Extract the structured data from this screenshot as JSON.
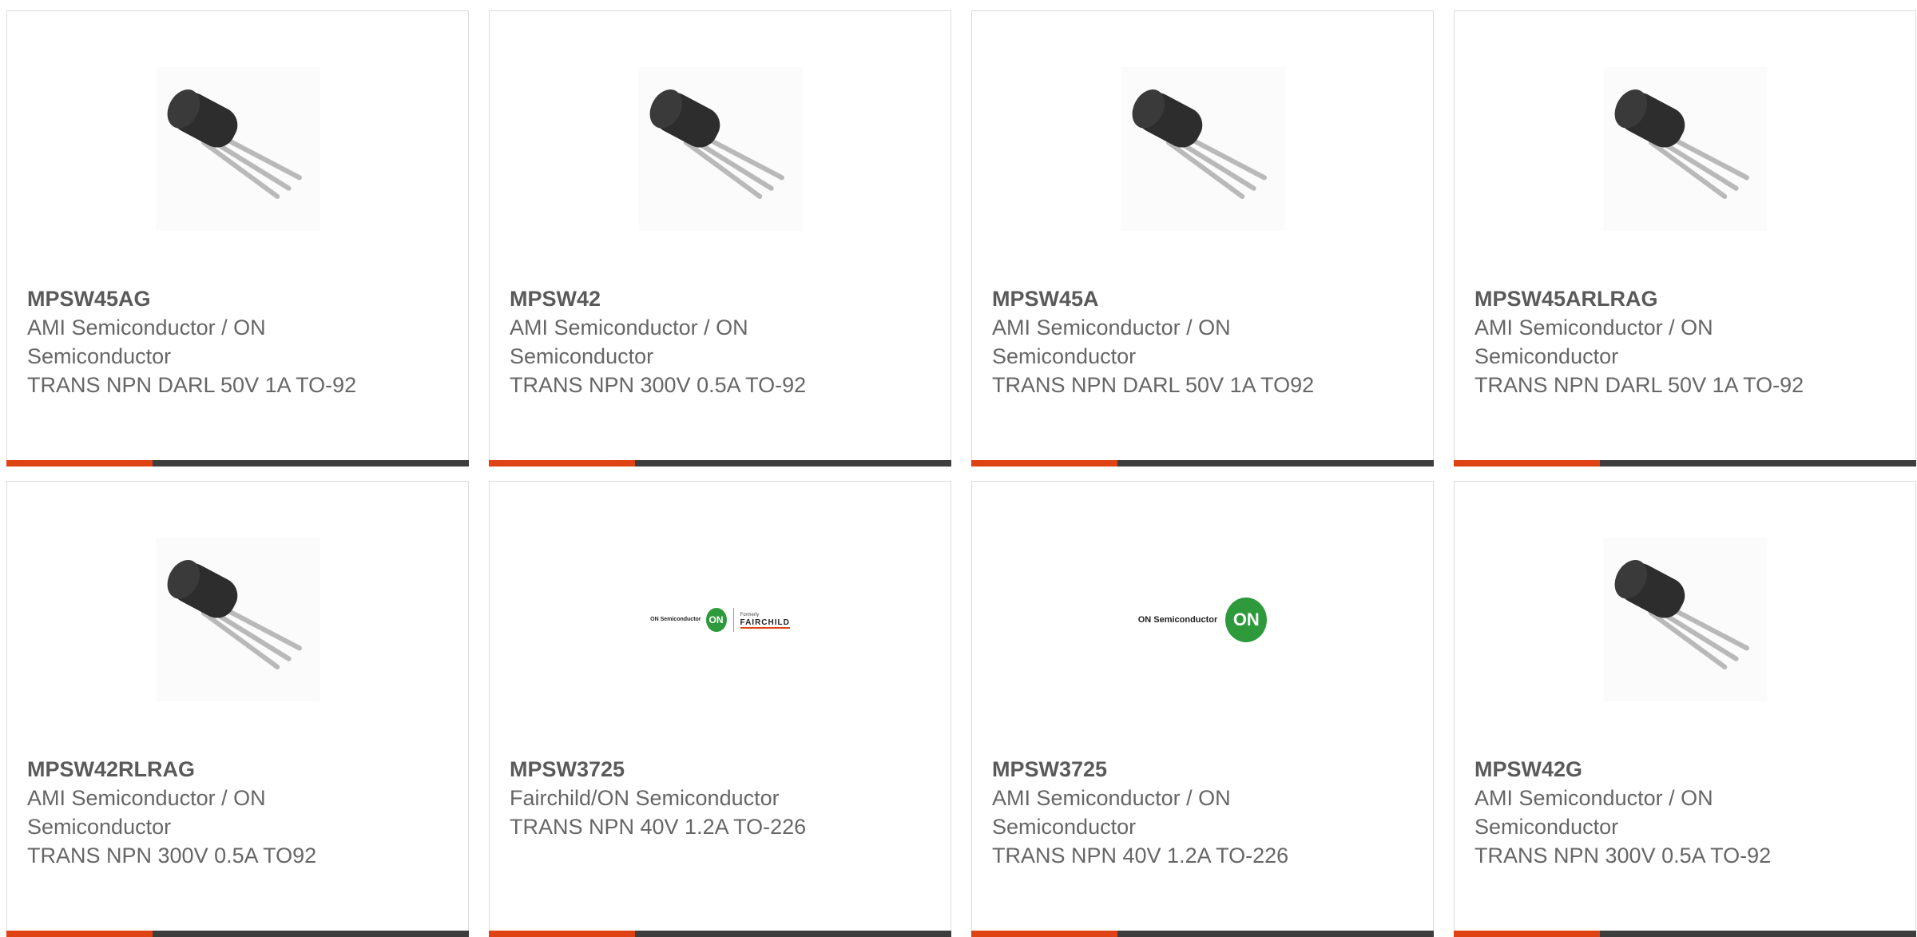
{
  "products": [
    {
      "part": "MPSW45AG",
      "mfr": "AMI Semiconductor / ON Semiconductor",
      "desc": "TRANS NPN DARL 50V 1A TO-92",
      "image": "transistor-to92"
    },
    {
      "part": "MPSW42",
      "mfr": "AMI Semiconductor / ON Semiconductor",
      "desc": "TRANS NPN 300V 0.5A TO-92",
      "image": "transistor-to92"
    },
    {
      "part": "MPSW45A",
      "mfr": "AMI Semiconductor / ON Semiconductor",
      "desc": "TRANS NPN DARL 50V 1A TO92",
      "image": "transistor-to92"
    },
    {
      "part": "MPSW45ARLRAG",
      "mfr": "AMI Semiconductor / ON Semiconductor",
      "desc": "TRANS NPN DARL 50V 1A TO-92",
      "image": "transistor-to92"
    },
    {
      "part": "MPSW42RLRAG",
      "mfr": "AMI Semiconductor / ON Semiconductor",
      "desc": "TRANS NPN 300V 0.5A TO92",
      "image": "transistor-to92"
    },
    {
      "part": "MPSW3725",
      "mfr": "Fairchild/ON Semiconductor",
      "desc": "TRANS NPN 40V 1.2A TO-226",
      "image": "fairchild-on-logo"
    },
    {
      "part": "MPSW3725",
      "mfr": "AMI Semiconductor / ON Semiconductor",
      "desc": "TRANS NPN 40V 1.2A TO-226",
      "image": "on-semiconductor-logo"
    },
    {
      "part": "MPSW42G",
      "mfr": "AMI Semiconductor / ON Semiconductor",
      "desc": "TRANS NPN 300V 0.5A TO-92",
      "image": "transistor-to92"
    }
  ],
  "logos": {
    "on_semi_text": "ON Semiconductor",
    "on_badge": "ON",
    "formerly": "Formerly",
    "fairchild": "FAIRCHILD"
  },
  "colors": {
    "accent": "#e04313",
    "bar": "#3d3d3d",
    "on_green": "#2e9a3c"
  }
}
